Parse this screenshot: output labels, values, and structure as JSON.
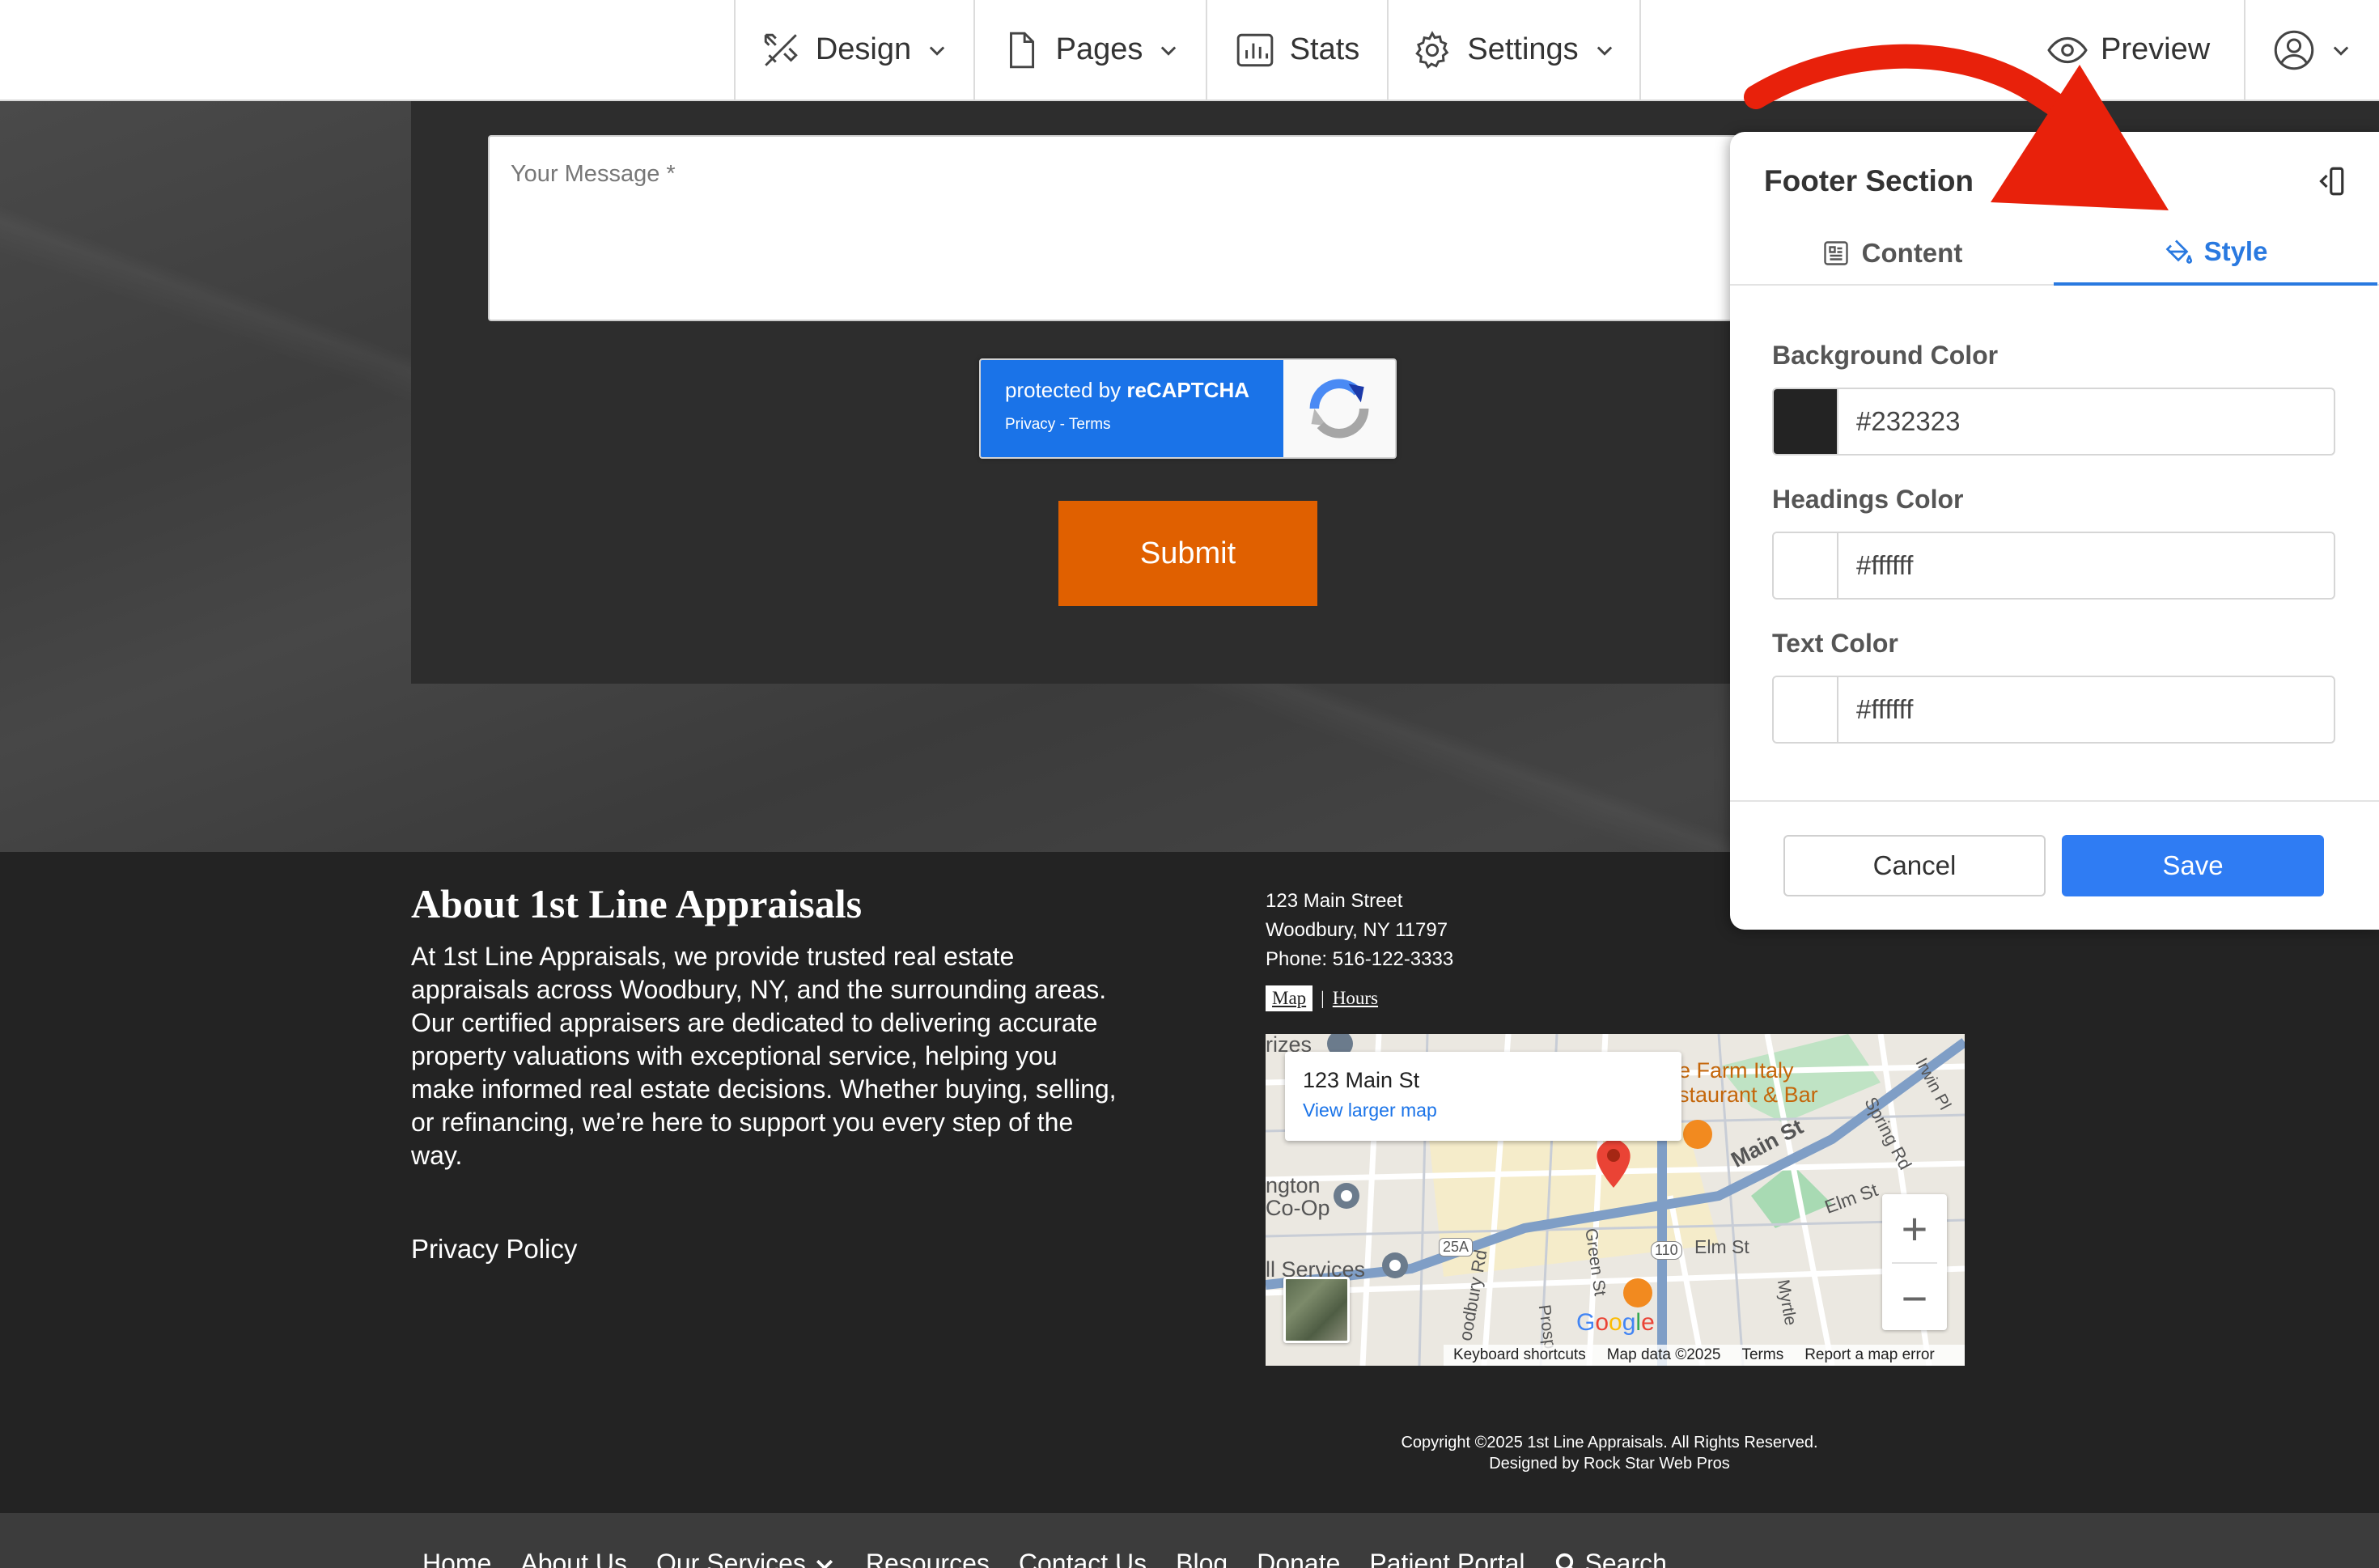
{
  "toolbar": {
    "design": "Design",
    "pages": "Pages",
    "stats": "Stats",
    "settings": "Settings",
    "preview": "Preview"
  },
  "form": {
    "message_placeholder": "Your Message *",
    "recaptcha_text": "protected by",
    "recaptcha_brand": "reCAPTCHA",
    "recaptcha_links": "Privacy - Terms",
    "submit_label": "Submit"
  },
  "footer": {
    "about_title": "About 1st Line Appraisals",
    "about_text": "At 1st Line Appraisals, we provide trusted real estate appraisals across Woodbury, NY, and the surrounding areas. Our certified appraisers are dedicated to delivering accurate property valuations with exceptional service, helping you make informed real estate decisions. Whether buying, selling, or refinancing, we’re here to support you every step of the way.",
    "privacy_link": "Privacy Policy",
    "address_line1": "123 Main Street",
    "address_line2": "Woodbury, NY 11797",
    "phone": "Phone: 516-122-3333",
    "map_tab": "Map",
    "hours_tab": "Hours",
    "copyright": "Copyright ©2025 1st Line Appraisals. All Rights Reserved.",
    "designed_by": "Designed by Rock Star Web Pros"
  },
  "map": {
    "card_title": "123 Main St",
    "card_link": "View larger map",
    "zoom_in": "+",
    "zoom_out": "−",
    "keyboard_shortcuts": "Keyboard shortcuts",
    "map_data": "Map data ©2025",
    "terms": "Terms",
    "report": "Report a map error",
    "labels": {
      "farm": "e Farm Italy",
      "bar": "staurant & Bar",
      "coop1": "ngton",
      "coop2": "Co-Op",
      "services": "ll Services",
      "main_st": "Main St",
      "elm_st": "Elm St",
      "elm_st2": "Elm St",
      "spring_rd": "Spring Rd",
      "irwin_pl": "Irwin Pl",
      "green_st": "Green St",
      "prosp": "Prosp",
      "woodbury_rd": "oodbury Rd",
      "myrtle": "Myrtle",
      "rizes": "rizes",
      "route_25a": "25A",
      "route_110": "110"
    }
  },
  "bottom_nav": {
    "items": [
      "Home",
      "About Us",
      "Our Services",
      "Resources",
      "Contact Us",
      "Blog",
      "Donate",
      "Patient Portal",
      "Search"
    ]
  },
  "panel": {
    "title": "Footer Section",
    "tab_content": "Content",
    "tab_style": "Style",
    "background_label": "Background Color",
    "background_value": "#232323",
    "headings_label": "Headings Color",
    "headings_value": "#ffffff",
    "text_label": "Text Color",
    "text_value": "#ffffff",
    "cancel": "Cancel",
    "save": "Save"
  },
  "colors": {
    "accent_blue": "#2f7cf3",
    "submit_orange": "#e06000",
    "annotation_red": "#e8210b"
  }
}
